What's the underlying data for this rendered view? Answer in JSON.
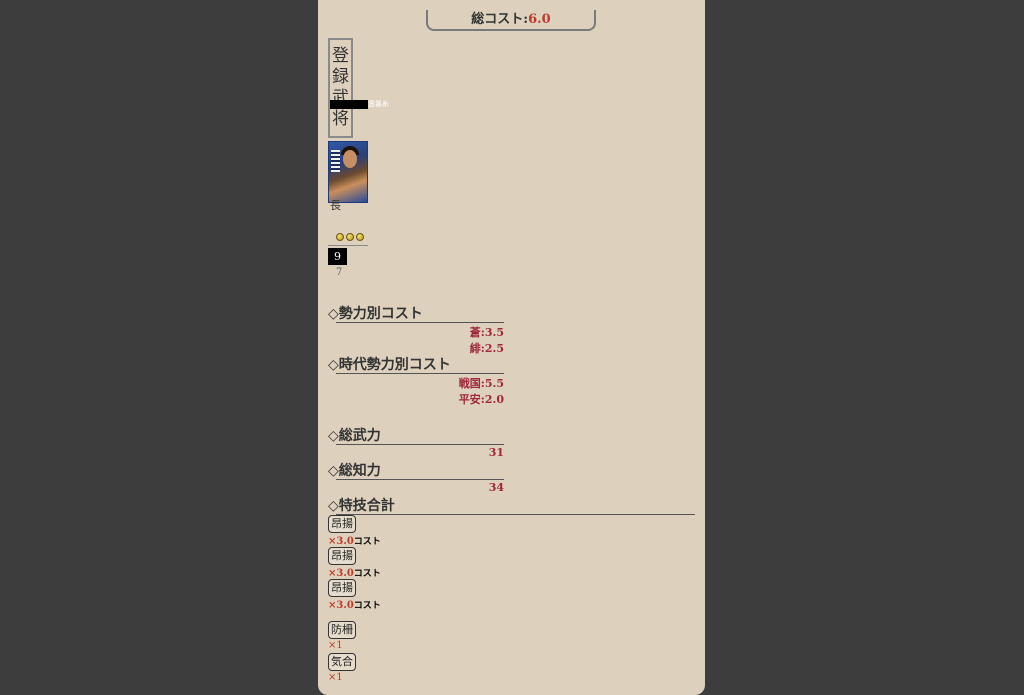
{
  "total_cost": {
    "label": "総コスト:",
    "value": "6.0"
  },
  "registered_label": [
    "登",
    "録",
    "武",
    "将"
  ],
  "tag_text": "霊暴糸",
  "card": {
    "char": "長",
    "rank_dots": 3,
    "number": "9",
    "sub_number": "7"
  },
  "faction_cost": {
    "title": "◇勢力別コスト",
    "items": [
      {
        "label": "蒼:",
        "value": "3.5"
      },
      {
        "label": "緋:",
        "value": "2.5"
      }
    ]
  },
  "era_cost": {
    "title": "◇時代勢力別コスト",
    "items": [
      {
        "label": "戦国:",
        "value": "5.5"
      },
      {
        "label": "平安:",
        "value": "2.0"
      }
    ]
  },
  "total_force": {
    "title": "◇総武力",
    "value": "31"
  },
  "total_intel": {
    "title": "◇総知力",
    "value": "34"
  },
  "skills": {
    "title": "◇特技合計",
    "items": [
      {
        "label": "昂揚",
        "mult": "×3.0",
        "unit": "コスト"
      },
      {
        "label": "昂揚",
        "mult": "×3.0",
        "unit": "コスト"
      },
      {
        "label": "昂揚",
        "mult": "×3.0",
        "unit": "コスト"
      },
      {
        "label": "防柵",
        "mult": "×1",
        "unit": ""
      },
      {
        "label": "気合",
        "mult": "×1",
        "unit": ""
      }
    ]
  },
  "colors": {
    "background": "#3d3d3d",
    "panel": "#ddd0bc",
    "value_red": "#a0283a"
  }
}
